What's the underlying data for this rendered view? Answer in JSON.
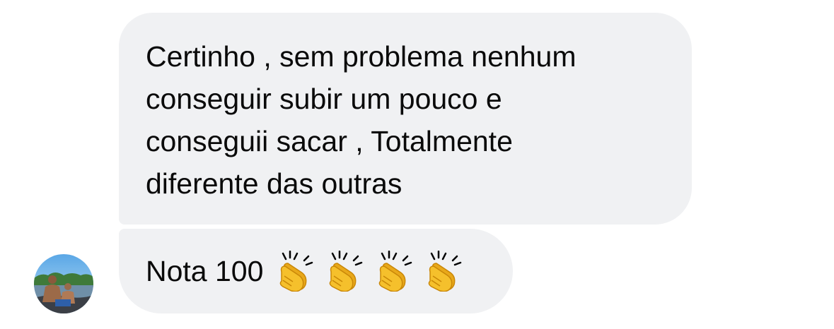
{
  "messages": [
    {
      "text": "Certinho , sem problema nenhum\nconseguir subir um pouco e\nconseguii sacar , Totalmente\ndiferente das outras"
    },
    {
      "text": "Nota 100",
      "emojis": [
        "clapping-hands",
        "clapping-hands",
        "clapping-hands",
        "clapping-hands"
      ]
    }
  ],
  "colors": {
    "bubble_background": "#f0f1f3",
    "text": "#0a0a0a",
    "emoji_yellow": "#f5c02c"
  }
}
